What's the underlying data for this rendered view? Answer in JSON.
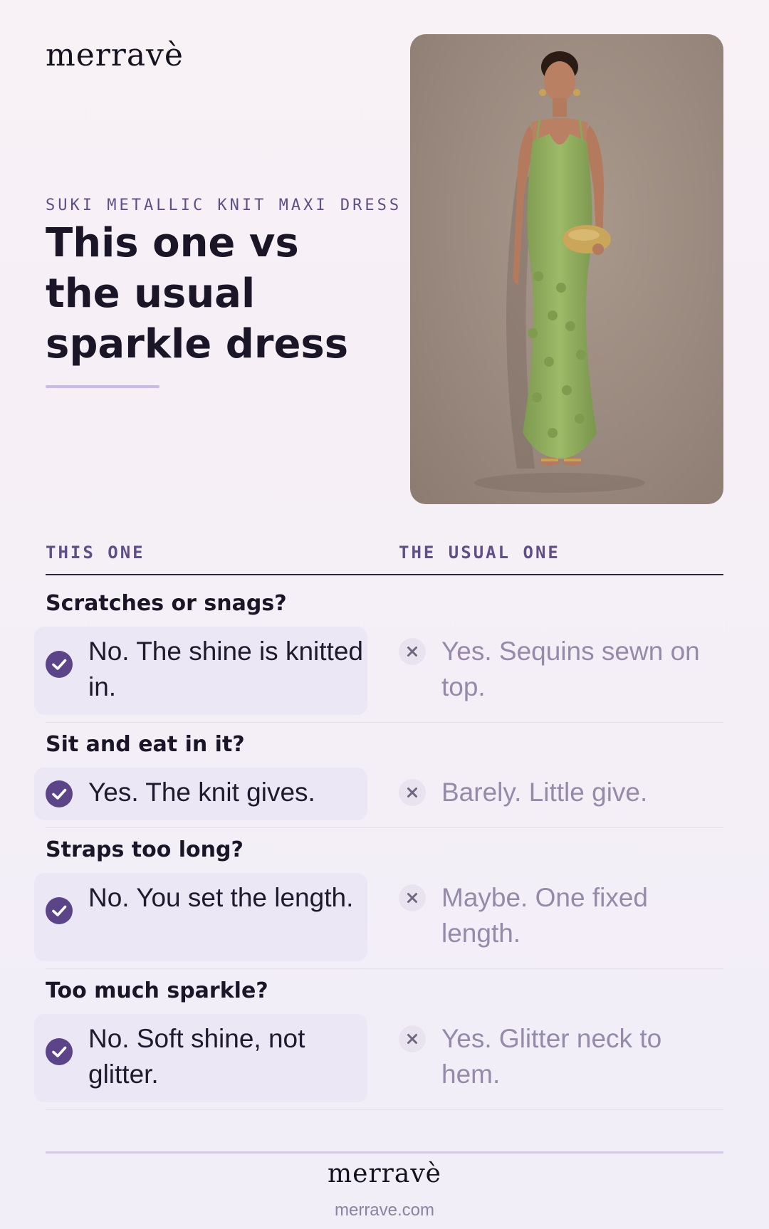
{
  "brand": {
    "logo": "merravè",
    "url": "merrave.com"
  },
  "header": {
    "eyebrow": "SUKI METALLIC KNIT MAXI DRESS",
    "title": "This one vs the usual sparkle dress"
  },
  "table": {
    "col_left": "THIS ONE",
    "col_right": "THE USUAL ONE",
    "rows": [
      {
        "question": "Scratches or snags?",
        "this_one": "No. The shine is knitted in.",
        "usual": "Yes. Sequins sewn on top."
      },
      {
        "question": "Sit and eat in it?",
        "this_one": "Yes. The knit gives.",
        "usual": "Barely. Little give."
      },
      {
        "question": "Straps too long?",
        "this_one": "No. You set the length.",
        "usual": "Maybe. One fixed length."
      },
      {
        "question": "Too much sparkle?",
        "this_one": "No. Soft shine, not glitter.",
        "usual": "Yes. Glitter neck to hem."
      }
    ]
  },
  "colors": {
    "accent": "#5e4f86",
    "check": "#5b4487",
    "muted_text": "#958aa8",
    "dress": "#93b062",
    "backdrop": "#9a897e"
  },
  "icons": {
    "yes": "check-circle-icon",
    "no": "x-circle-icon"
  }
}
